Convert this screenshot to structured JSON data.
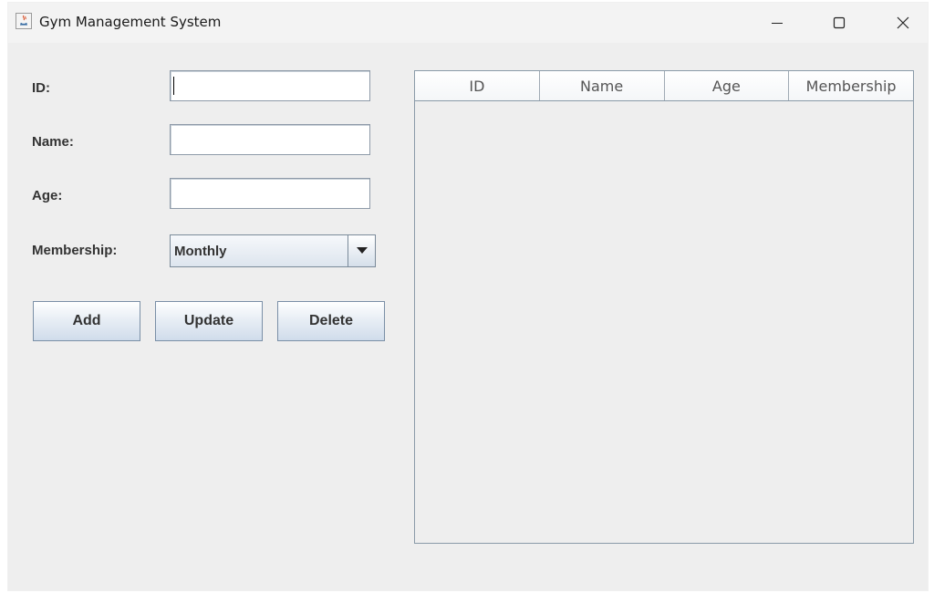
{
  "window": {
    "title": "Gym Management System",
    "controls": [
      "minimize",
      "maximize",
      "close"
    ]
  },
  "form": {
    "id_label": "ID:",
    "id_value": "",
    "name_label": "Name:",
    "name_value": "",
    "age_label": "Age:",
    "age_value": "",
    "membership_label": "Membership:",
    "membership_value": "Monthly"
  },
  "buttons": {
    "add": "Add",
    "update": "Update",
    "delete": "Delete"
  },
  "table": {
    "columns": [
      "ID",
      "Name",
      "Age",
      "Membership"
    ],
    "rows": []
  }
}
